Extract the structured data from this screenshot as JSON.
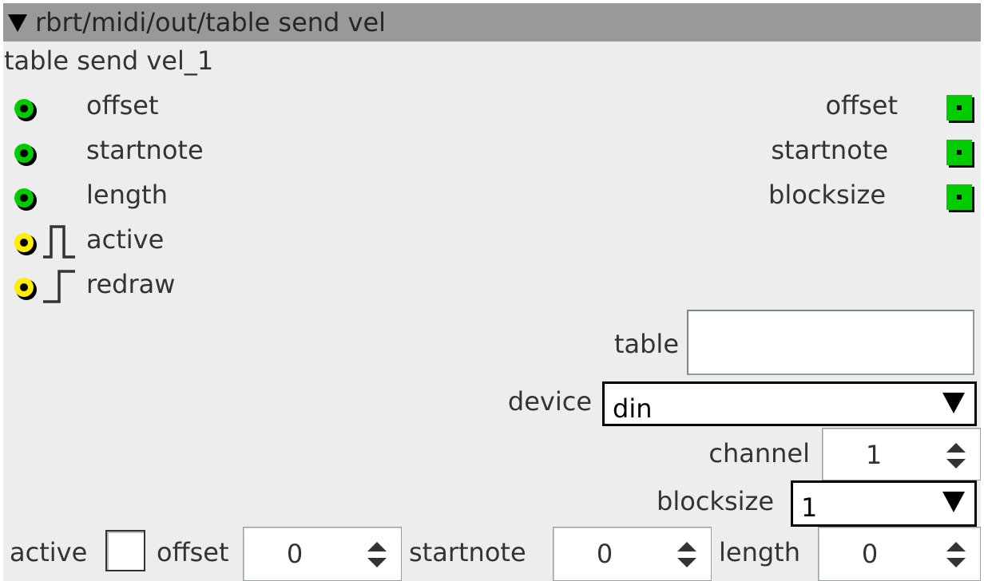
{
  "window": {
    "title": "rbrt/midi/out/table send vel",
    "instance_name": "table send vel_1"
  },
  "colors": {
    "titlebar": "#999999",
    "panel": "#ededed",
    "inlet_green": "#00cc00",
    "inlet_yellow": "#ffee00"
  },
  "inlets": [
    {
      "label": "offset",
      "type": "int32",
      "color": "green"
    },
    {
      "label": "startnote",
      "type": "int32",
      "color": "green"
    },
    {
      "label": "length",
      "type": "int32",
      "color": "green"
    },
    {
      "label": "active",
      "type": "bool-pulse",
      "color": "yellow"
    },
    {
      "label": "redraw",
      "type": "bool-trigger",
      "color": "yellow"
    }
  ],
  "outlets": [
    {
      "label": "offset",
      "type": "int32"
    },
    {
      "label": "startnote",
      "type": "int32"
    },
    {
      "label": "blocksize",
      "type": "int32"
    }
  ],
  "attributes": {
    "table": {
      "label": "table",
      "value": ""
    },
    "device": {
      "label": "device",
      "value": "din"
    },
    "channel": {
      "label": "channel",
      "value": "1"
    },
    "blocksize": {
      "label": "blocksize",
      "value": "1"
    }
  },
  "params": {
    "active": {
      "label": "active",
      "checked": false
    },
    "offset": {
      "label": "offset",
      "value": "0"
    },
    "startnote": {
      "label": "startnote",
      "value": "0"
    },
    "length": {
      "label": "length",
      "value": "0"
    }
  }
}
